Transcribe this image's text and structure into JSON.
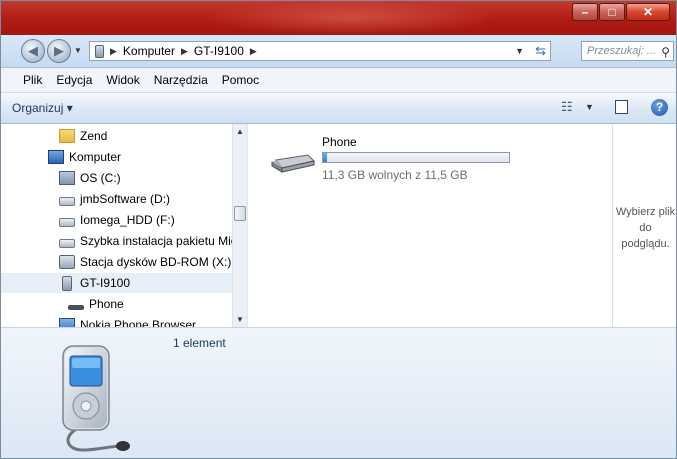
{
  "window": {
    "minimize_icon": "minimize-icon",
    "maximize_icon": "maximize-icon",
    "close_icon": "close-icon"
  },
  "address": {
    "segments": [
      "Komputer",
      "GT-I9100"
    ],
    "search_placeholder": "Przeszukaj: ..."
  },
  "menu": [
    "Plik",
    "Edycja",
    "Widok",
    "Narzędzia",
    "Pomoc"
  ],
  "toolbar": {
    "organize": "Organizuj ▾"
  },
  "nav": {
    "items": [
      {
        "label": "Zend",
        "icon": "folder-icon"
      },
      {
        "label": "Komputer",
        "icon": "computer-icon"
      },
      {
        "label": "OS (C:)",
        "icon": "system-drive-icon"
      },
      {
        "label": "jmbSoftware (D:)",
        "icon": "drive-icon"
      },
      {
        "label": "Iomega_HDD (F:)",
        "icon": "drive-icon"
      },
      {
        "label": "Szybka instalacja pakietu Mic",
        "icon": "drive-icon"
      },
      {
        "label": "Stacja dysków BD-ROM (X:)",
        "icon": "bd-rom-icon"
      },
      {
        "label": "GT-I9100",
        "icon": "phone-icon"
      },
      {
        "label": "Phone",
        "icon": "storage-icon"
      },
      {
        "label": "Nokia Phone Browser",
        "icon": "nokia-icon"
      }
    ]
  },
  "content": {
    "drive_name": "Phone",
    "free_text": "11,3 GB wolnych z 11,5 GB",
    "used_fraction": 0.017,
    "bar_color": "#2a7fd4"
  },
  "preview": {
    "line1": "Wybierz plik",
    "line2": "do",
    "line3": "podglądu."
  },
  "details": {
    "count": "1 element"
  },
  "colors": {
    "title_bar": "#b11b13",
    "selection": "#e6eef8"
  }
}
